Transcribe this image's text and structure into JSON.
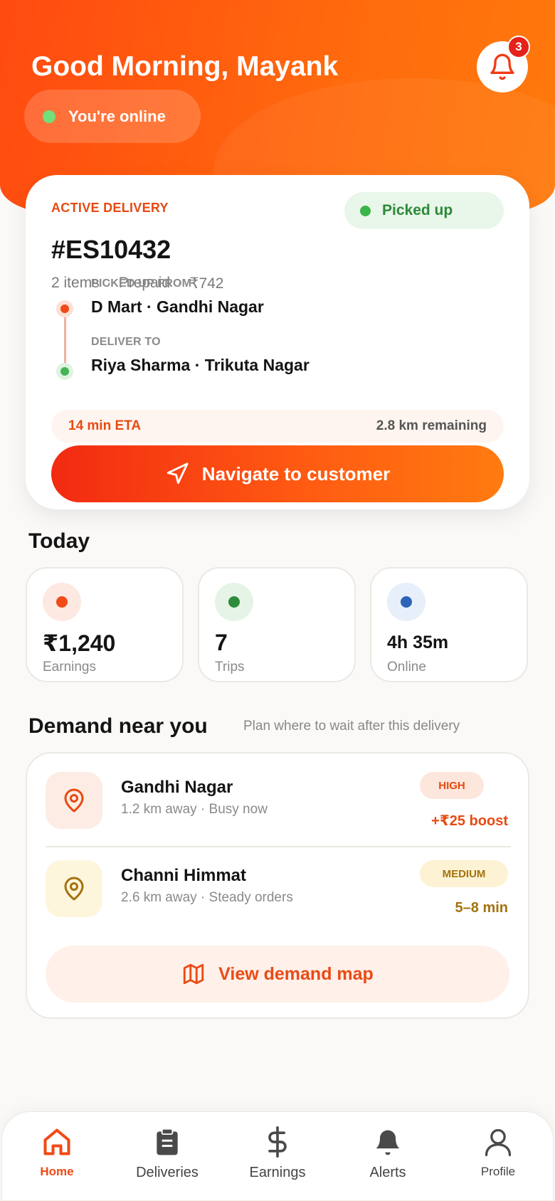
{
  "header": {
    "greeting": "Good Morning, Mayank",
    "online_status": "You're online",
    "notification_count": "3"
  },
  "active_delivery": {
    "label": "ACTIVE DELIVERY",
    "status": "Picked up",
    "order_id": "#ES10432",
    "items": "2 items",
    "payment": "Prepaid",
    "amount": "₹742",
    "separator": "·",
    "pickup_label": "PICKED UP FROM",
    "pickup_value": "D Mart · Gandhi Nagar",
    "drop_label": "DELIVER TO",
    "drop_value": "Riya Sharma · Trikuta Nagar",
    "eta": "14 min ETA",
    "distance": "2.8 km remaining",
    "navigate_label": "Navigate to customer"
  },
  "today": {
    "title": "Today",
    "stats": [
      {
        "value": "₹1,240",
        "label": "Earnings",
        "color": "#f14a18",
        "bg": "#fde9e1"
      },
      {
        "value": "7",
        "label": "Trips",
        "color": "#2e8b3a",
        "bg": "#e5f4e6"
      },
      {
        "value": "4h 35m",
        "label": "Online",
        "color": "#2d63b8",
        "bg": "#e7effa"
      }
    ]
  },
  "demand": {
    "title": "Demand near you",
    "subtitle": "Plan where to wait after this delivery",
    "zones": [
      {
        "name": "Gandhi Nagar",
        "sub": "1.2 km away · Busy now",
        "level": "HIGH",
        "extra": "+₹25 boost",
        "color": "#e64a12",
        "bg": "#fdece4",
        "pill_bg": "#fde6dc"
      },
      {
        "name": "Channi Himmat",
        "sub": "2.6 km away · Steady orders",
        "level": "MEDIUM",
        "extra": "5–8 min",
        "color": "#a4720d",
        "bg": "#fdf6dc",
        "pill_bg": "#fdf3d4"
      }
    ],
    "map_button": "View demand map"
  },
  "nav": {
    "items": [
      {
        "label": "Home",
        "icon": "home-icon"
      },
      {
        "label": "Deliveries",
        "icon": "clipboard-icon"
      },
      {
        "label": "Earnings",
        "icon": "dollar-icon"
      },
      {
        "label": "Alerts",
        "icon": "bell-icon"
      },
      {
        "label": "Profile",
        "icon": "user-icon"
      }
    ]
  }
}
